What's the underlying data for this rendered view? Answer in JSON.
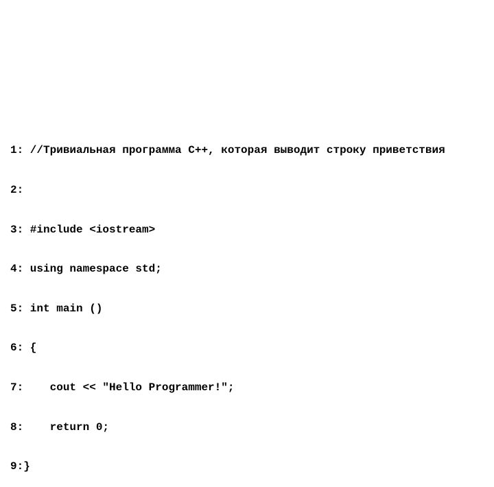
{
  "slide": {
    "code_lines": [
      "1: //Тривиальная программа С++, которая выводит строку приветствия",
      "2:",
      "3: #include <iostream>",
      "4: using namespace std;",
      "5: int main ()",
      "6: {",
      "7:    cout << \"Hello Programmer!\";",
      "8:    return 0;",
      "9:}"
    ]
  }
}
